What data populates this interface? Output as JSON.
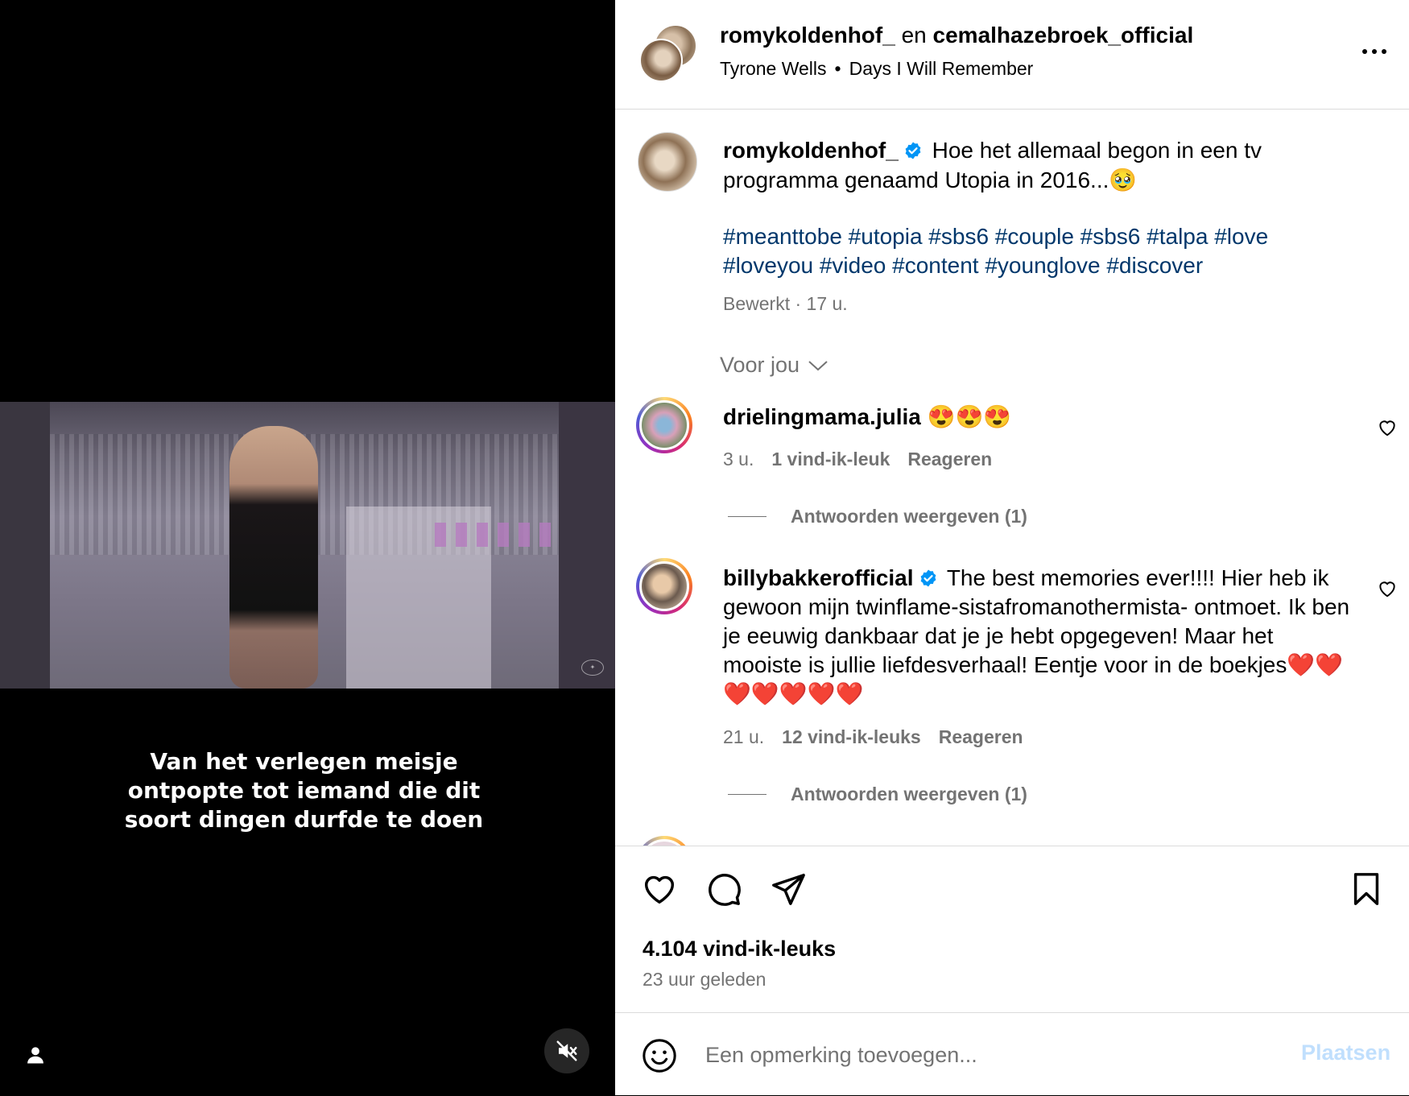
{
  "media": {
    "subtitle": "Van het verlegen meisje ontpopte tot iemand die dit soort dingen durfde te doen",
    "user_tag_icon": "user-icon",
    "mute_icon": "speaker-muted-icon"
  },
  "header": {
    "user1": "romykoldenhof_",
    "conjunction": "en",
    "user2": "cemalhazebroek_official",
    "music_artist": "Tyrone Wells",
    "music_separator": "•",
    "music_title": "Days I Will Remember",
    "more_icon": "more-options-icon"
  },
  "caption": {
    "username": "romykoldenhof_",
    "text": "Hoe het allemaal begon in een tv programma genaamd Utopia in 2016...🥹",
    "hashtags": "#meanttobe #utopia #sbs6 #couple #sbs6 #talpa #love #loveyou #video #content #younglove #discover",
    "edited": "Bewerkt · 17 u."
  },
  "filter": {
    "label": "Voor jou"
  },
  "comments": [
    {
      "username": "drielingmama.julia",
      "text": "😍😍😍",
      "time": "3 u.",
      "likes": "1 vind-ik-leuk",
      "reply": "Reageren",
      "view_replies": "Antwoorden weergeven (1)"
    },
    {
      "username": "billybakkerofficial",
      "text": "The best memories ever!!!! Hier heb ik gewoon mijn twinflame-sistafromanothermista- ontmoet. Ik ben je eeuwig dankbaar dat je je hebt opgegeven! Maar het mooiste is jullie liefdesverhaal! Eentje voor in de boekjes❤️❤️❤️❤️❤️❤️❤️",
      "time": "21 u.",
      "likes": "12 vind-ik-leuks",
      "reply": "Reageren",
      "view_replies": "Antwoorden weergeven (1)"
    }
  ],
  "actions": {
    "likes": "4.104 vind-ik-leuks",
    "time": "23 uur geleden",
    "icons": [
      "heart-icon",
      "comment-icon",
      "share-icon",
      "bookmark-icon"
    ]
  },
  "add_comment": {
    "placeholder": "Een opmerking toevoegen...",
    "post_label": "Plaatsen",
    "post_color": "#c0dffd"
  },
  "colors": {
    "hashtag": "#00376b",
    "secondary_text": "#737373",
    "verified": "#0095f6"
  }
}
